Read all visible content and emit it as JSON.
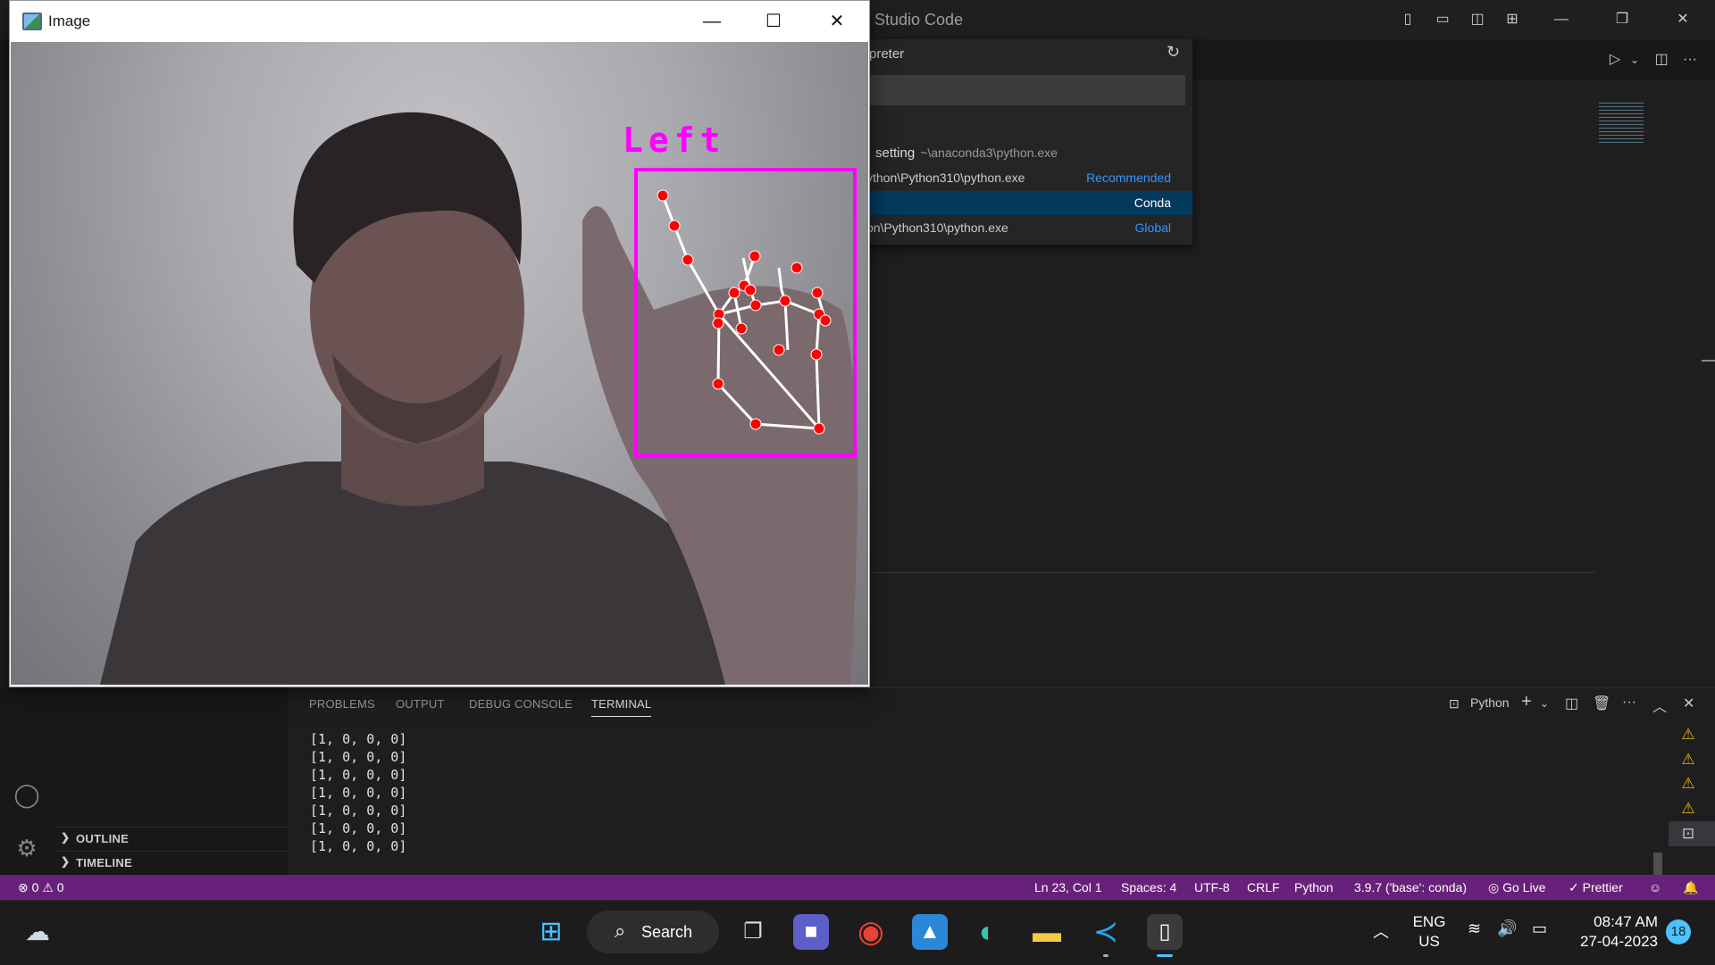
{
  "vscode": {
    "title": "al Studio Code",
    "quickpick": {
      "title": "rpreter",
      "rows": [
        {
          "main": "setting",
          "sub": "~\\anaconda3\\python.exe",
          "tag": ""
        },
        {
          "path": "ython\\Python310\\python.exe",
          "tag": "Recommended"
        },
        {
          "path": "",
          "tag": "Conda"
        },
        {
          "path": "on\\Python310\\python.exe",
          "tag": "Global"
        }
      ]
    },
    "sidebar": {
      "outline": "OUTLINE",
      "timeline": "TIMELINE"
    },
    "panel": {
      "tabs": [
        "PROBLEMS",
        "OUTPUT",
        "DEBUG CONSOLE",
        "TERMINAL"
      ],
      "terminal_name": "Python",
      "terminal_lines": [
        "[1, 0, 0, 0]",
        "[1, 0, 0, 0]",
        "[1, 0, 0, 0]",
        "[1, 0, 0, 0]",
        "[1, 0, 0, 0]",
        "[1, 0, 0, 0]",
        "[1, 0, 0, 0]"
      ]
    },
    "statusbar": {
      "errors": "0",
      "warnings": "0",
      "position": "Ln 23, Col 1",
      "spaces": "Spaces: 4",
      "encoding": "UTF-8",
      "eol": "CRLF",
      "language": "Python",
      "interpreter": "3.9.7 ('base': conda)",
      "golive": "Go Live",
      "prettier": "Prettier"
    }
  },
  "image_window": {
    "title": "Image",
    "label": "Left",
    "box_color": "#ff00ff",
    "landmark_color": "#ff0000"
  },
  "taskbar": {
    "search_label": "Search",
    "lang_line1": "ENG",
    "lang_line2": "US",
    "time": "08:47 AM",
    "date": "27-04-2023",
    "badge": "18"
  },
  "colors": {
    "statusbar": "#68217a",
    "accent": "#3794ff",
    "warning": "#e5b90b"
  }
}
